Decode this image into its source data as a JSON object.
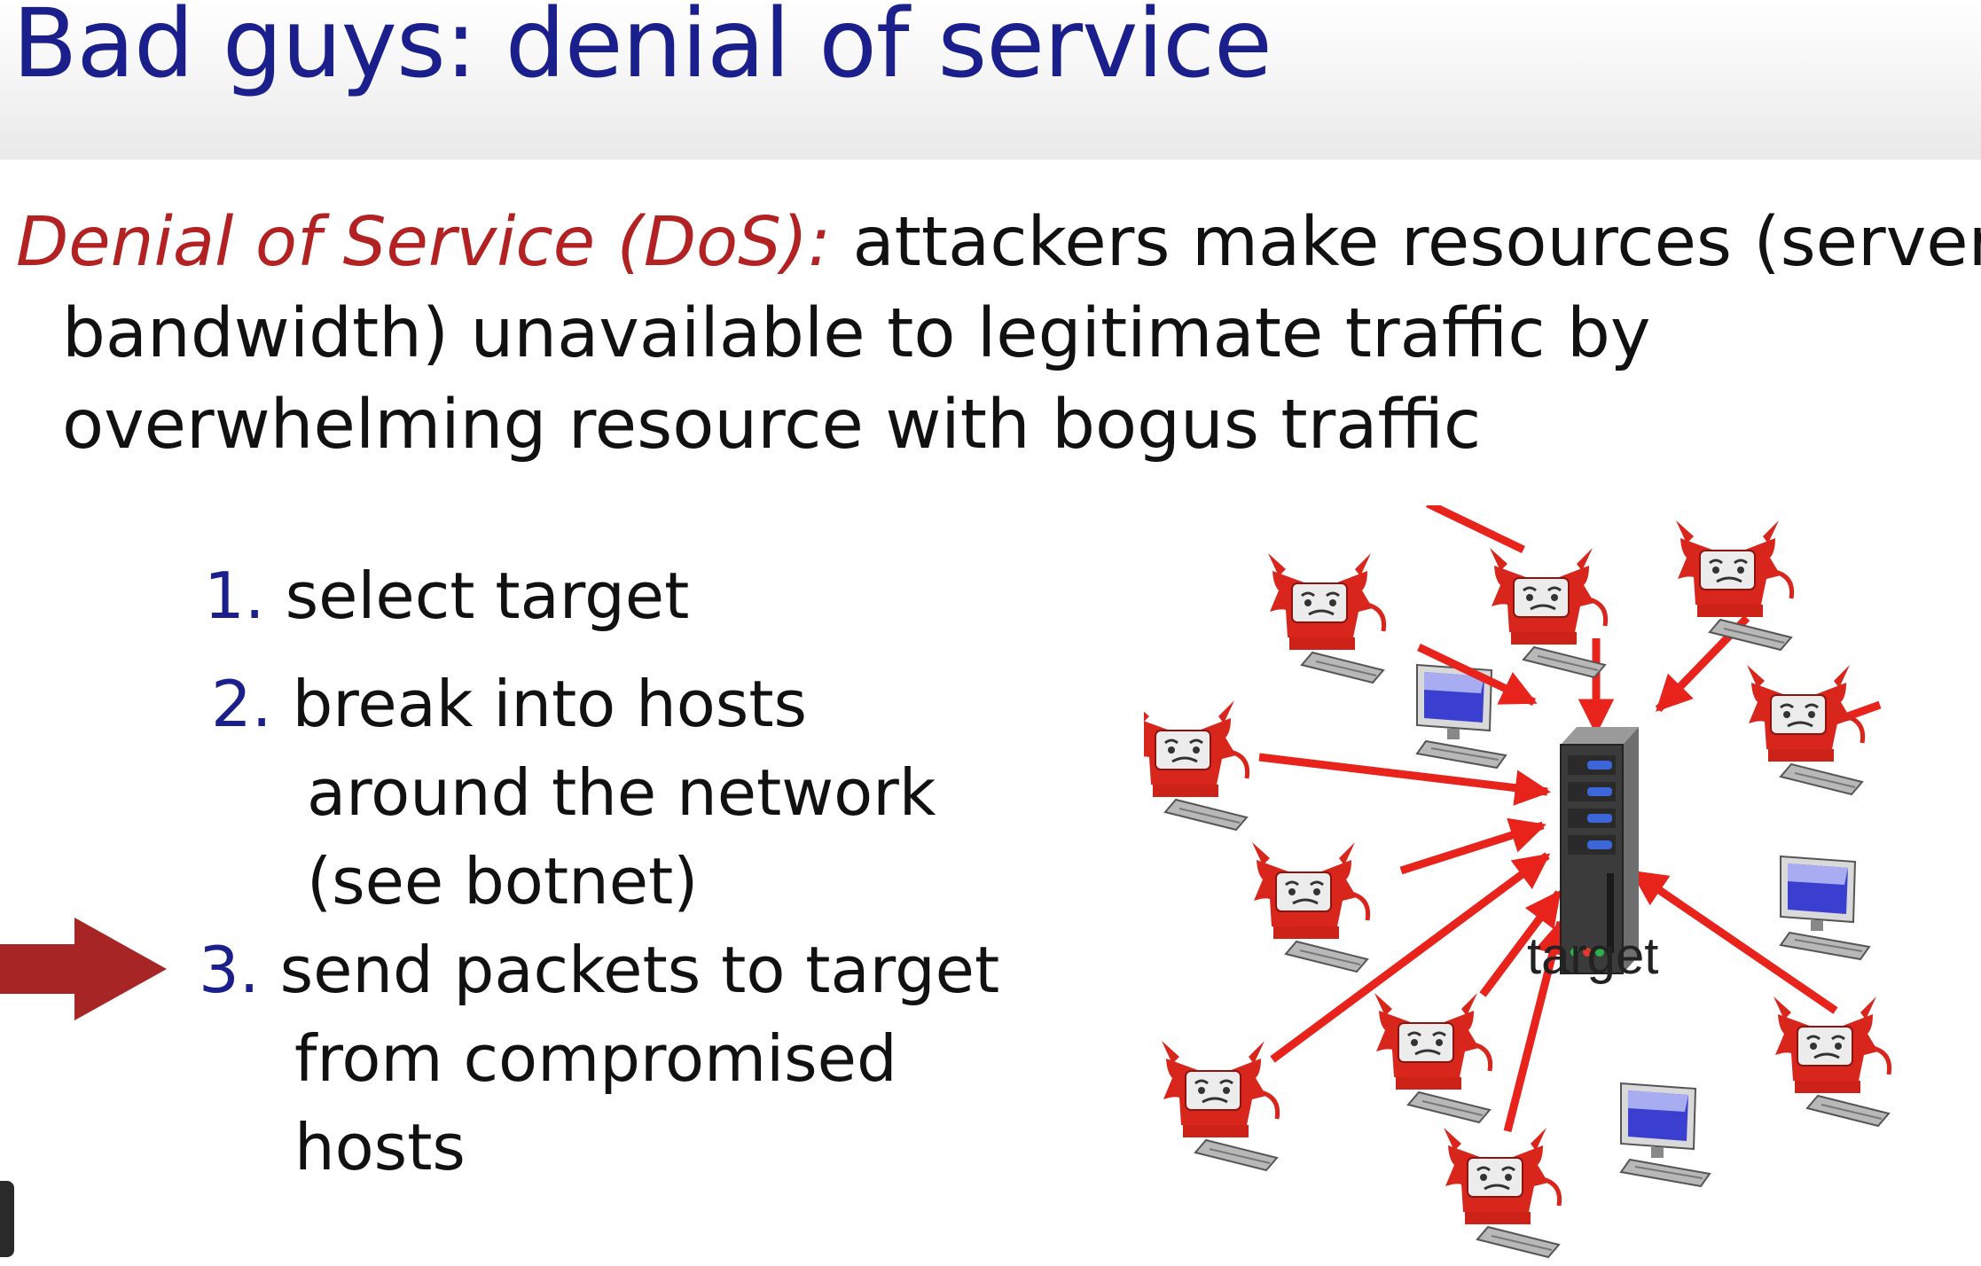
{
  "title": "Bad guys: denial of service",
  "definition": {
    "term": "Denial of Service (DoS):",
    "line1": "attackers make resources (server,",
    "line2": "bandwidth) unavailable to legitimate traffic by",
    "line3": "overwhelming resource with bogus traffic"
  },
  "steps": [
    {
      "num": "1.",
      "lines": [
        "select target"
      ]
    },
    {
      "num": "2.",
      "lines": [
        "break into hosts",
        "around the network",
        "(see botnet)"
      ]
    },
    {
      "num": "3.",
      "lines": [
        "send packets to target",
        "from compromised",
        "hosts"
      ]
    }
  ],
  "diagram": {
    "target_label": "target",
    "colors": {
      "attack_arrow": "#e8231c",
      "pointer_arrow": "#a82525",
      "attacker": "#d9261c",
      "screen": "#3a3fd0"
    }
  }
}
